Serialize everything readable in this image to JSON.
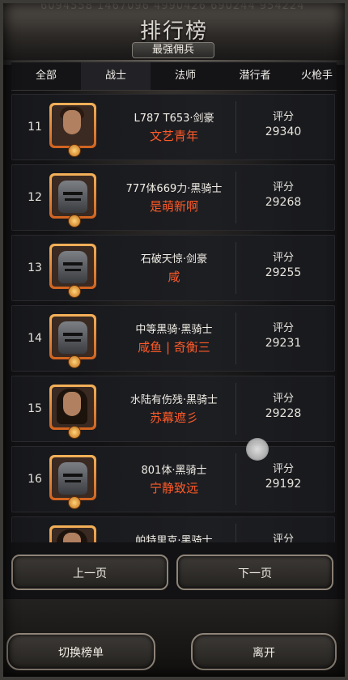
{
  "header": {
    "faint_numbers": "6094558  1467096  4990426  690244  954224",
    "title": "排行榜",
    "subtitle": "最强佣兵"
  },
  "tabs": [
    {
      "label": "全部",
      "active": false
    },
    {
      "label": "战士",
      "active": true
    },
    {
      "label": "法师",
      "active": false
    },
    {
      "label": "潜行者",
      "active": false
    },
    {
      "label": "火枪手",
      "active": false
    }
  ],
  "rows": [
    {
      "rank": "11",
      "title_line": "L787 T653·剑豪",
      "player": "文艺青年",
      "score_label": "评分",
      "score": "29340",
      "avatar": "warrior-face-icon"
    },
    {
      "rank": "12",
      "title_line": "777体669力·黑骑士",
      "player": "是萌新啊",
      "score_label": "评分",
      "score": "29268",
      "avatar": "black-knight-helm-icon"
    },
    {
      "rank": "13",
      "title_line": "石破天惊·剑豪",
      "player": "咸",
      "score_label": "评分",
      "score": "29255",
      "avatar": "black-knight-helm-icon"
    },
    {
      "rank": "14",
      "title_line": "中等黑骑·黑骑士",
      "player": "咸鱼 | 奇衡三",
      "score_label": "评分",
      "score": "29231",
      "avatar": "black-knight-helm-icon"
    },
    {
      "rank": "15",
      "title_line": "水陆有伤残·黑骑士",
      "player": "苏幕遮彡",
      "score_label": "评分",
      "score": "29228",
      "avatar": "long-hair-face-icon"
    },
    {
      "rank": "16",
      "title_line": "801体·黑骑士",
      "player": "宁静致远",
      "score_label": "评分",
      "score": "29192",
      "avatar": "black-knight-helm-icon"
    },
    {
      "rank": "",
      "title_line": "帕特里克·黑骑士",
      "player": "",
      "score_label": "评分",
      "score": "",
      "avatar": "long-hair-face-icon"
    }
  ],
  "pager": {
    "prev_label": "上一页",
    "next_label": "下一页"
  },
  "footer": {
    "switch_label": "切换榜单",
    "leave_label": "离开"
  },
  "colors": {
    "player_name": "#ff5a28",
    "avatar_frame": "#e58a38"
  }
}
